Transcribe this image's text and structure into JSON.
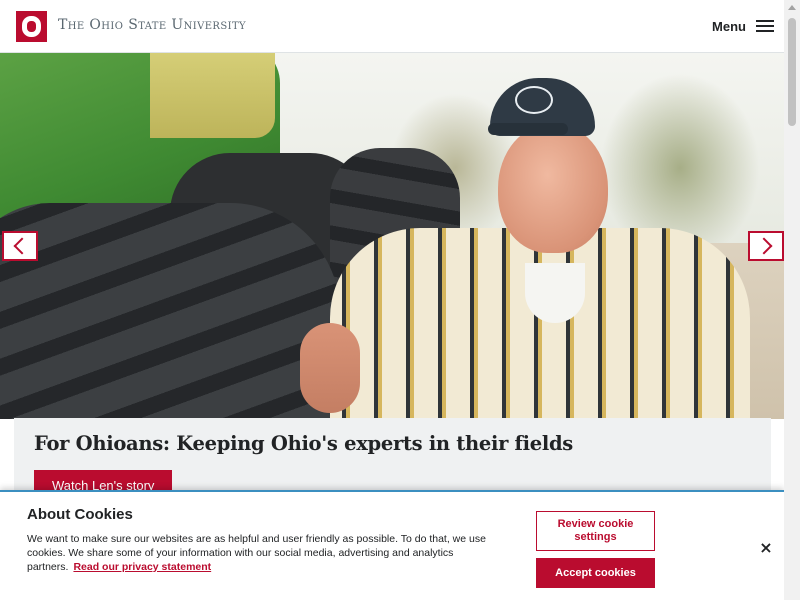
{
  "header": {
    "wordmark": "The Ohio State University",
    "menu_label": "Menu"
  },
  "hero": {
    "caption_title": "For Ohioans: Keeping Ohio's experts in their fields",
    "cta_label": "Watch Len's story"
  },
  "cookie_banner": {
    "title": "About Cookies",
    "body": "We want to make sure our websites are as helpful and user friendly as possible. To do that, we use cookies. We share some of your information with our social media, advertising and analytics partners.",
    "privacy_link": "Read our privacy statement",
    "review_label": "Review cookie settings",
    "accept_label": "Accept cookies",
    "close_symbol": "×"
  },
  "colors": {
    "brand_scarlet": "#ba0c2f",
    "gray_text": "#5a6770",
    "caption_bg": "#eff1f2"
  }
}
